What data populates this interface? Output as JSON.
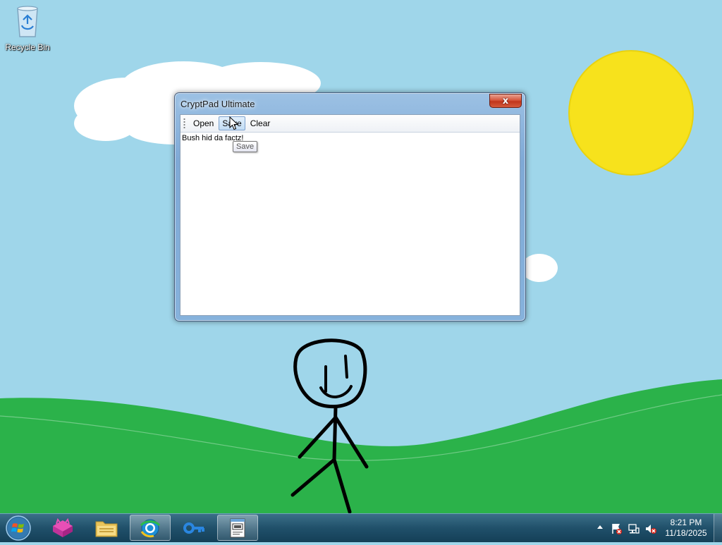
{
  "desktop": {
    "icons": [
      {
        "label": "Recycle Bin",
        "icon": "recycle-bin-icon"
      }
    ]
  },
  "window": {
    "title": "CryptPad Ultimate",
    "close_symbol": "x",
    "toolbar": {
      "open_label": "Open",
      "save_label": "Save",
      "clear_label": "Clear"
    },
    "editor_text": "Bush hid da factz!",
    "tooltip": "Save"
  },
  "taskbar": {
    "apps": [
      {
        "name": "paint-app",
        "icon": "paw-box-icon"
      },
      {
        "name": "explorer",
        "icon": "folder-icon"
      },
      {
        "name": "browser",
        "icon": "browser-globe-icon"
      },
      {
        "name": "key-app",
        "icon": "key-icon"
      },
      {
        "name": "cryptpad",
        "icon": "notepad-icon"
      }
    ],
    "clock": {
      "time": "8:21 PM",
      "date": "11/18/2025"
    }
  },
  "colors": {
    "sky": "#9fd6ea",
    "grass": "#2bb24a",
    "sun": "#f7e21c",
    "taskbar": "#1f4e66",
    "titlebar": "#86b2dc"
  }
}
